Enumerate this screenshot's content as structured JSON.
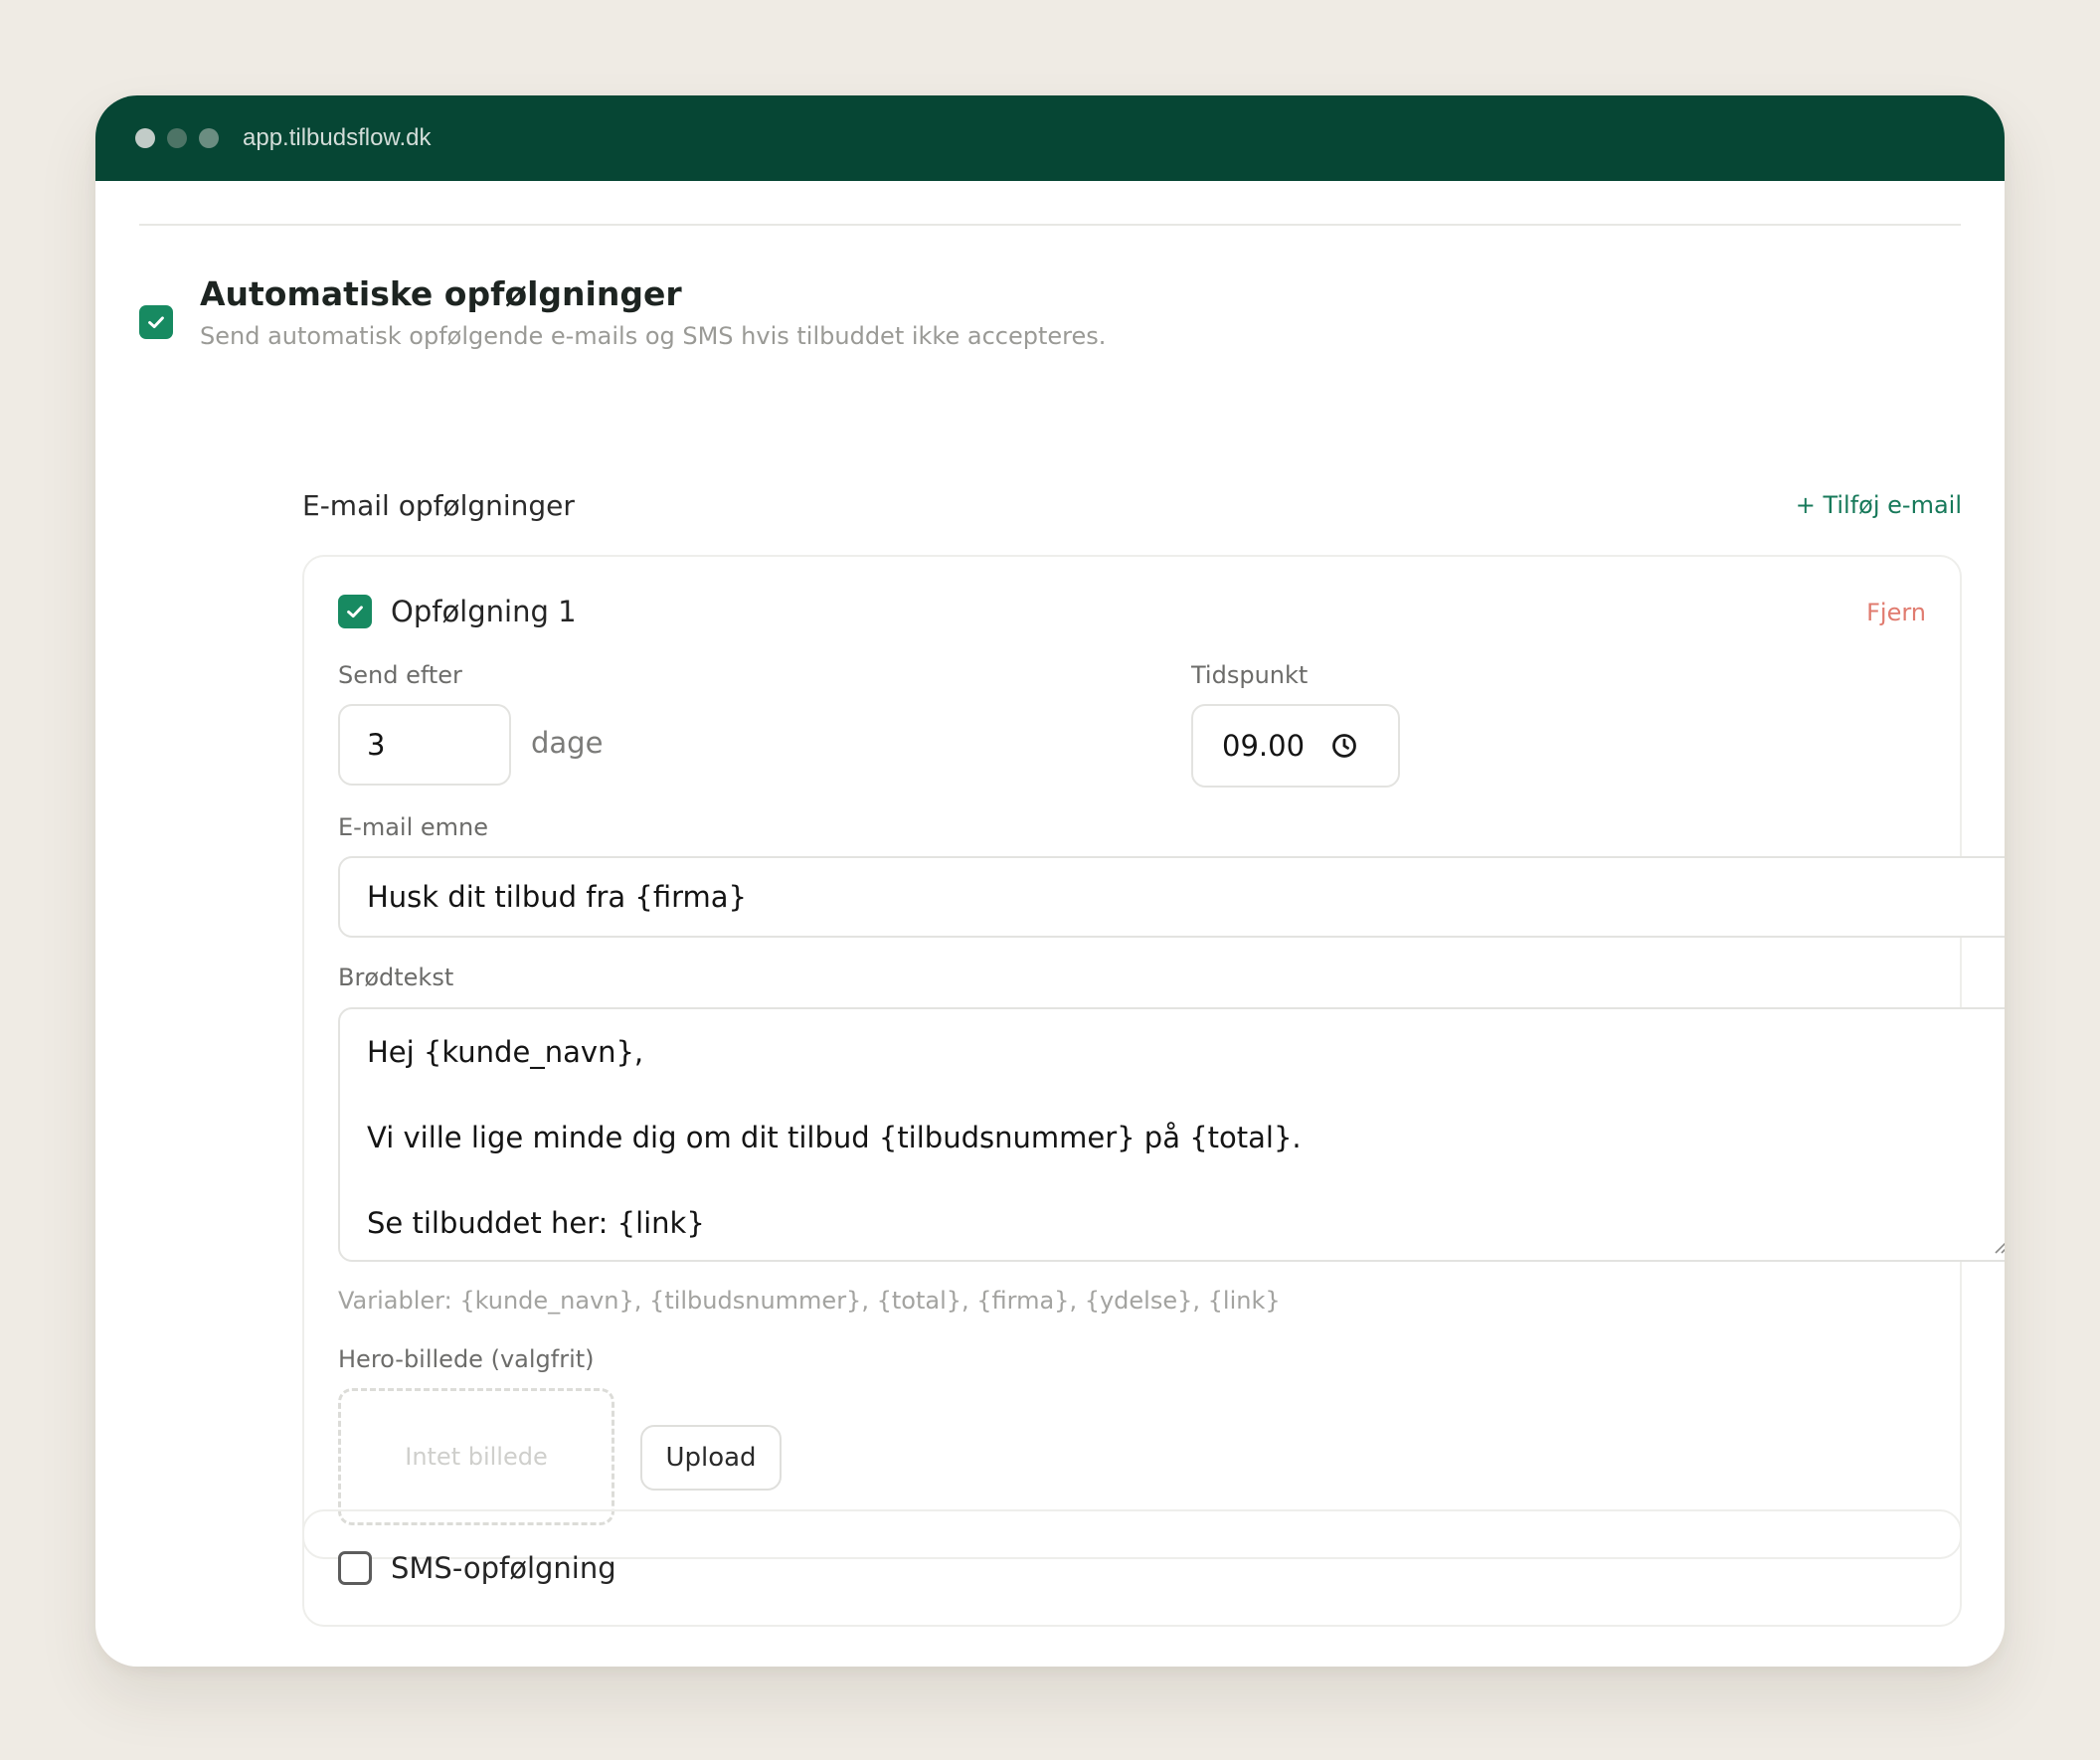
{
  "window": {
    "url": "app.tilbudsflow.dk"
  },
  "automation": {
    "enabled": true,
    "title": "Automatiske opfølgninger",
    "subtitle": "Send automatisk opfølgende e-mails og SMS hvis tilbuddet ikke accepteres."
  },
  "email_followups": {
    "heading": "E-mail opfølgninger",
    "add_label": "+ Tilføj e-mail",
    "items": [
      {
        "enabled": true,
        "title": "Opfølgning 1",
        "remove_label": "Fjern",
        "send_after_label": "Send efter",
        "send_after_value": "3",
        "send_after_unit": "dage",
        "time_label": "Tidspunkt",
        "time_value": "09.00",
        "subject_label": "E-mail emne",
        "subject_value": "Husk dit tilbud fra {firma}",
        "body_label": "Brødtekst",
        "body_lines": [
          "Hej {kunde_navn},",
          "",
          "Vi ville lige minde dig om dit tilbud {tilbudsnummer} på {total}.",
          "",
          "Se tilbuddet her: {link}"
        ],
        "variables_hint": "Variabler: {kunde_navn}, {tilbudsnummer}, {total}, {firma}, {ydelse}, {link}",
        "hero_label": "Hero-billede (valgfrit)",
        "hero_placeholder": "Intet billede",
        "upload_label": "Upload"
      }
    ]
  },
  "sms_followup": {
    "enabled": false,
    "label": "SMS-opfølgning"
  },
  "colors": {
    "titlebar": "#064634",
    "accent": "#178a61",
    "link": "#17795a",
    "danger": "#e07b6f",
    "background": "#efebe4"
  },
  "icons": {
    "checkbox_checked": "check-icon",
    "time": "clock-icon",
    "resize": "resize-handle-icon"
  }
}
